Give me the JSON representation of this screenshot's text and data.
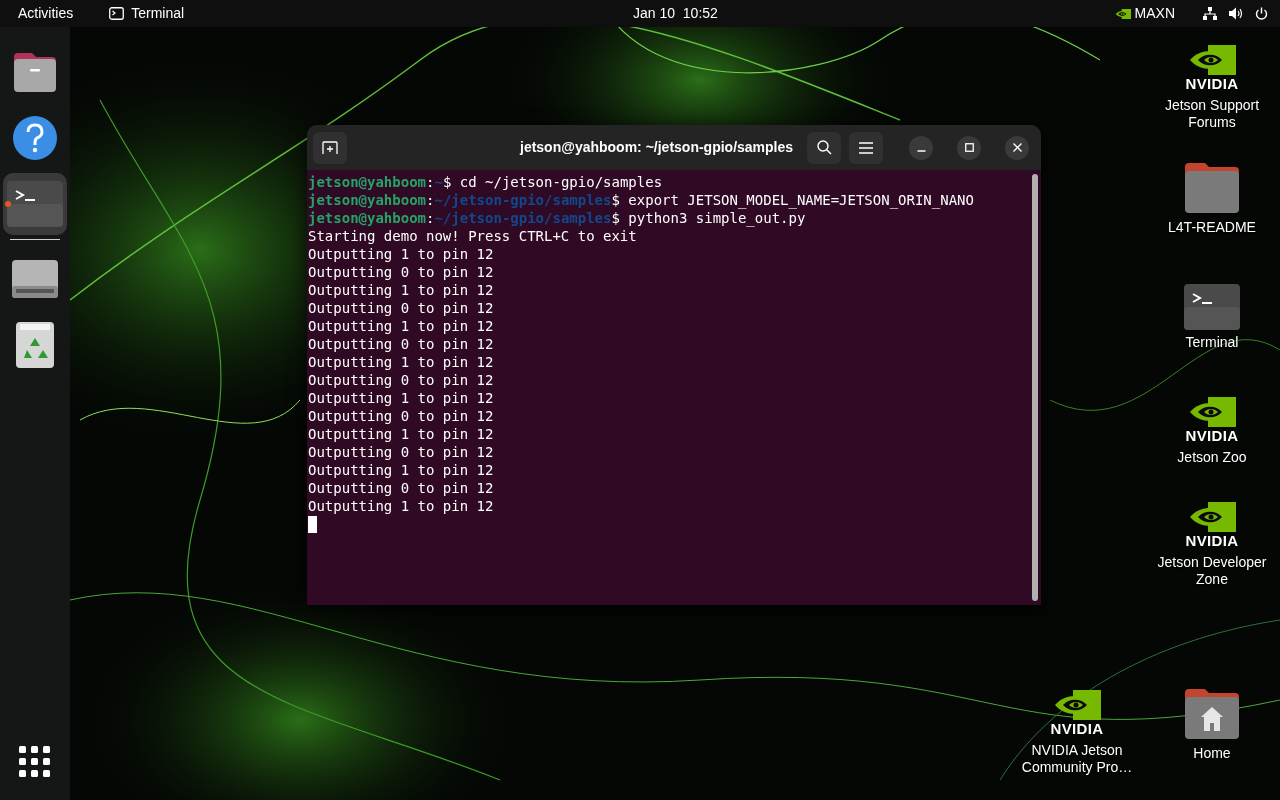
{
  "top_bar": {
    "activities": "Activities",
    "app_name": "Terminal",
    "clock": "Jan 10  10:52",
    "power_mode": "MAXN"
  },
  "dock": {
    "items": [
      {
        "kind": "files",
        "selected": false,
        "running": false
      },
      {
        "kind": "help",
        "selected": false,
        "running": false
      },
      {
        "kind": "terminal",
        "selected": true,
        "running": true
      },
      {
        "kind": "drive",
        "selected": false,
        "running": false
      },
      {
        "kind": "trash",
        "selected": false,
        "running": false
      }
    ]
  },
  "terminal": {
    "title": "jetson@yahboom: ~/jetson-gpio/samples",
    "lines": [
      {
        "kind": "prompt",
        "user": "jetson@yahboom",
        "separator": ":",
        "path": "~",
        "symbol": "$",
        "command": "cd ~/jetson-gpio/samples"
      },
      {
        "kind": "prompt",
        "user": "jetson@yahboom",
        "separator": ":",
        "path": "~/jetson-gpio/samples",
        "symbol": "$",
        "command": "export JETSON_MODEL_NAME=JETSON_ORIN_NANO"
      },
      {
        "kind": "prompt",
        "user": "jetson@yahboom",
        "separator": ":",
        "path": "~/jetson-gpio/samples",
        "symbol": "$",
        "command": "python3 simple_out.py"
      },
      {
        "kind": "output",
        "text": "Starting demo now! Press CTRL+C to exit"
      },
      {
        "kind": "output",
        "text": "Outputting 1 to pin 12"
      },
      {
        "kind": "output",
        "text": "Outputting 0 to pin 12"
      },
      {
        "kind": "output",
        "text": "Outputting 1 to pin 12"
      },
      {
        "kind": "output",
        "text": "Outputting 0 to pin 12"
      },
      {
        "kind": "output",
        "text": "Outputting 1 to pin 12"
      },
      {
        "kind": "output",
        "text": "Outputting 0 to pin 12"
      },
      {
        "kind": "output",
        "text": "Outputting 1 to pin 12"
      },
      {
        "kind": "output",
        "text": "Outputting 0 to pin 12"
      },
      {
        "kind": "output",
        "text": "Outputting 1 to pin 12"
      },
      {
        "kind": "output",
        "text": "Outputting 0 to pin 12"
      },
      {
        "kind": "output",
        "text": "Outputting 1 to pin 12"
      },
      {
        "kind": "output",
        "text": "Outputting 0 to pin 12"
      },
      {
        "kind": "output",
        "text": "Outputting 1 to pin 12"
      },
      {
        "kind": "output",
        "text": "Outputting 0 to pin 12"
      },
      {
        "kind": "output",
        "text": "Outputting 1 to pin 12"
      }
    ]
  },
  "desktop_icons": [
    {
      "kind": "nvidia",
      "logo_text": "NVIDIA",
      "label": "Jetson Support Forums"
    },
    {
      "kind": "folder",
      "label": "L4T-README"
    },
    {
      "kind": "terminal",
      "label": "Terminal"
    },
    {
      "kind": "nvidia",
      "logo_text": "NVIDIA",
      "label": "Jetson Zoo"
    },
    {
      "kind": "nvidia",
      "logo_text": "NVIDIA",
      "label": "Jetson Developer Zone"
    },
    {
      "kind": "nvidia",
      "logo_text": "NVIDIA",
      "label": "NVIDIA Jetson Community Pro…"
    },
    {
      "kind": "home",
      "label": "Home"
    }
  ]
}
